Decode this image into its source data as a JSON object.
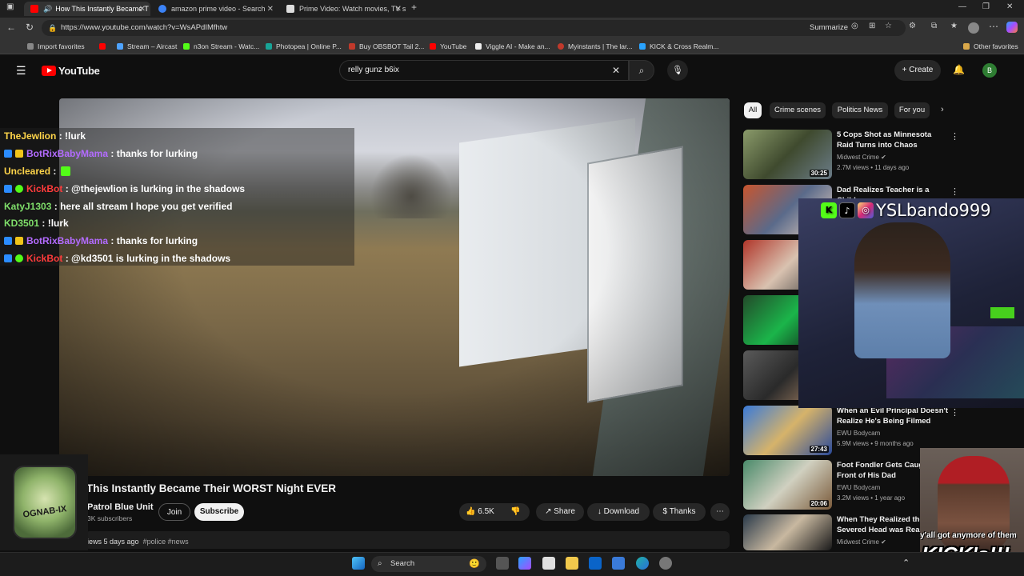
{
  "browser": {
    "tabs": [
      {
        "label": "How This Instantly Became T",
        "active": true
      },
      {
        "label": "amazon prime video - Search",
        "active": false
      },
      {
        "label": "Prime Video: Watch movies, TV sh",
        "active": false
      }
    ],
    "url": "https://www.youtube.com/watch?v=WsAPdIMfhtw",
    "summarize_label": "Summarize",
    "bookmarks": [
      "Import favorites",
      "Stream – Aircast",
      "n3on Stream - Watc...",
      "Photopea | Online P...",
      "Buy OBSBOT Tail 2...",
      "YouTube",
      "Viggle AI - Make an...",
      "Myinstants | The lar...",
      "KICK & Cross Realm..."
    ],
    "other_favorites": "Other favorites"
  },
  "youtube": {
    "logo_text": "YouTube",
    "search_value": "relly gunz b6ix",
    "create_label": "Create",
    "avatar_letter": "B",
    "chips": [
      "All",
      "Crime scenes",
      "Politics News",
      "For you"
    ],
    "video": {
      "title": "This Instantly Became Their WORST Night EVER",
      "channel": "Patrol Blue Unit",
      "subscribers": "3K subscribers",
      "join_label": "Join",
      "subscribe_label": "Subscribe",
      "likes": "6.5K",
      "share_label": "Share",
      "download_label": "Download",
      "thanks_label": "Thanks",
      "meta": "iews  5 days ago",
      "tags": "#police #news"
    },
    "recommendations": [
      {
        "title": "5 Cops Shot as Minnesota Raid Turns into Chaos",
        "channel": "Midwest Crime",
        "stats": "2.7M views • 11 days ago",
        "duration": "30:25"
      },
      {
        "title": "Dad Realizes Teacher is a Child",
        "channel": "",
        "stats": "",
        "duration": ""
      },
      {
        "title": "When an Evil Principal Doesn't Realize He's Being Filmed",
        "channel": "EWU Bodycam",
        "stats": "5.9M views • 9 months ago",
        "duration": "27:43"
      },
      {
        "title": "Foot Fondler Gets Caught Front of His Dad",
        "channel": "EWU Bodycam",
        "stats": "3.2M views • 1 year ago",
        "duration": "20:06"
      },
      {
        "title": "When They Realized the Severed Head was Real",
        "channel": "Midwest Crime",
        "stats": "",
        "duration": ""
      }
    ]
  },
  "chat": [
    {
      "user": "TheJewlion",
      "color": "#ffd54a",
      "msg": ": !lurk",
      "badge": false
    },
    {
      "user": "BotRixBabyMama",
      "color": "#b36bff",
      "msg": ": thanks for lurking",
      "badge": true
    },
    {
      "user": "Uncleared",
      "color": "#ffd54a",
      "msg": ":",
      "badge": false
    },
    {
      "user": "KickBot",
      "color": "#ff3b3b",
      "msg": ": @thejewlion is lurking in the shadows",
      "badge": true
    },
    {
      "user": "KatyJ1303",
      "color": "#7fdf6a",
      "msg": ": here all stream I hope you get verified",
      "badge": false
    },
    {
      "user": "KD3501",
      "color": "#7fdf6a",
      "msg": ": !lurk",
      "badge": false
    },
    {
      "user": "BotRixBabyMama",
      "color": "#b36bff",
      "msg": ": thanks for lurking",
      "badge": true
    },
    {
      "user": "KickBot",
      "color": "#ff3b3b",
      "msg": ": @kd3501 is lurking in the shadows",
      "badge": true
    }
  ],
  "stream_overlay": {
    "handle": "YSLbando999",
    "meme_caption": "y'all got anymore of them",
    "meme_big": "KICK's!!!",
    "logo_text": "OGNAB-IX"
  },
  "taskbar": {
    "search_placeholder": "Search"
  }
}
